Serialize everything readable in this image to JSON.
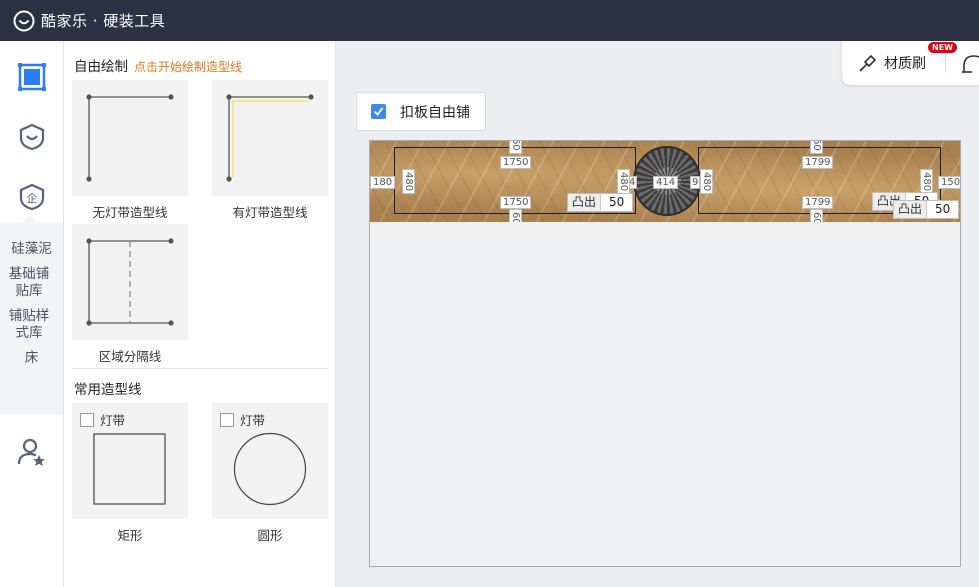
{
  "app": {
    "title": "酷家乐 · 硬装工具"
  },
  "rail": {
    "sub_items": [
      "硅藻泥",
      "基础铺贴库",
      "铺贴样式库",
      "床"
    ],
    "accent": "#2f7df6"
  },
  "panel": {
    "free_draw": {
      "title": "自由绘制",
      "hint": "点击开始绘制造型线"
    },
    "free_cards": [
      {
        "label": "无灯带造型线"
      },
      {
        "label": "有灯带造型线"
      },
      {
        "label": "区域分隔线"
      }
    ],
    "common": {
      "title": "常用造型线"
    },
    "common_cards": [
      {
        "label": "矩形",
        "checkbox": "灯带",
        "checked": false
      },
      {
        "label": "圆形",
        "checkbox": "灯带",
        "checked": false
      }
    ]
  },
  "toolbar": {
    "material_brush": "材质刷",
    "badge": "NEW"
  },
  "canvas": {
    "free_tile": {
      "label": "扣板自由铺",
      "checked": true
    },
    "dims": {
      "top_left": "1750",
      "bottom_left": "1750",
      "top_right": "1799",
      "bottom_right": "1799",
      "left_outer": "180",
      "right_outer": "150",
      "medallion": "414",
      "v60_top_left": "60",
      "v60_bottom_left": "60",
      "v60_top_right": "60",
      "v60_bottom_right": "60",
      "v480_a": "480",
      "v480_b": "480",
      "v480_c": "480",
      "v480_d": "480",
      "small_4": "4",
      "small_9": "9"
    },
    "bumps": [
      {
        "key": "凸出",
        "value": "50"
      },
      {
        "key": "凸出",
        "value": "50"
      },
      {
        "key": "凸出",
        "value": "50"
      }
    ]
  }
}
